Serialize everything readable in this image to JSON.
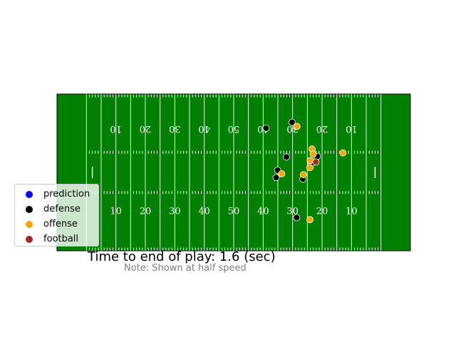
{
  "chart_data": {
    "type": "scatter",
    "title": "",
    "field": {
      "background_color": "#008000",
      "line_color": "#ffffff",
      "x_range": [
        0,
        120
      ],
      "y_range": [
        0,
        53.3
      ],
      "yard_numbers_top": [
        "10",
        "20",
        "30",
        "40",
        "50",
        "40",
        "30",
        "20",
        "10"
      ],
      "yard_numbers_bottom": [
        "10",
        "20",
        "30",
        "40",
        "50",
        "40",
        "30",
        "20",
        "10"
      ]
    },
    "legend": {
      "position": "lower-left",
      "entries": [
        {
          "label": "prediction",
          "color": "#0000ff"
        },
        {
          "label": "defense",
          "color": "#000000"
        },
        {
          "label": "offense",
          "color": "#ffa500"
        },
        {
          "label": "football",
          "color": "#a52a2a"
        }
      ]
    },
    "series": [
      {
        "name": "defense",
        "color": "#000000",
        "points": [
          {
            "x": 71.0,
            "y": 41.7
          },
          {
            "x": 79.8,
            "y": 43.7
          },
          {
            "x": 77.9,
            "y": 31.9
          },
          {
            "x": 74.9,
            "y": 27.4
          },
          {
            "x": 74.4,
            "y": 24.9
          },
          {
            "x": 83.5,
            "y": 24.4
          },
          {
            "x": 86.3,
            "y": 29.6
          },
          {
            "x": 88.4,
            "y": 32.1
          },
          {
            "x": 81.4,
            "y": 11.3
          }
        ]
      },
      {
        "name": "offense",
        "color": "#ffa500",
        "points": [
          {
            "x": 81.5,
            "y": 42.3
          },
          {
            "x": 86.6,
            "y": 34.6
          },
          {
            "x": 87.0,
            "y": 32.9
          },
          {
            "x": 86.0,
            "y": 30.7
          },
          {
            "x": 85.9,
            "y": 28.3
          },
          {
            "x": 76.3,
            "y": 26.2
          },
          {
            "x": 83.7,
            "y": 25.9
          },
          {
            "x": 97.1,
            "y": 33.3
          },
          {
            "x": 85.9,
            "y": 10.6
          }
        ]
      },
      {
        "name": "football",
        "color": "#a52a2a",
        "points": [
          {
            "x": 87.9,
            "y": 30.2
          }
        ]
      }
    ],
    "annotations": [
      "Time to end of play: 1.6 (sec)",
      "Note: Shown at half speed"
    ]
  },
  "labels": {
    "time": "Time to end of play: 1.6 (sec)",
    "note": "Note: Shown at half speed"
  }
}
